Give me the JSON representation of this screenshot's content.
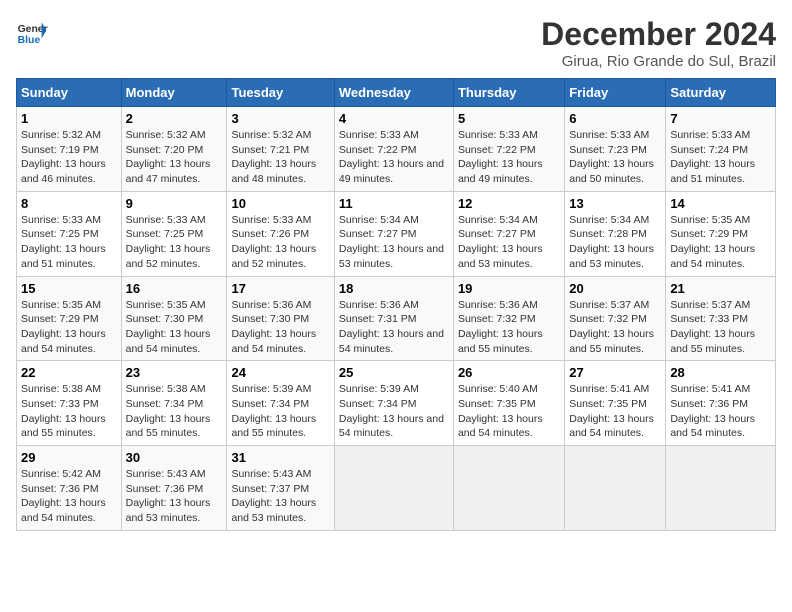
{
  "header": {
    "logo_line1": "General",
    "logo_line2": "Blue",
    "title": "December 2024",
    "subtitle": "Girua, Rio Grande do Sul, Brazil"
  },
  "weekdays": [
    "Sunday",
    "Monday",
    "Tuesday",
    "Wednesday",
    "Thursday",
    "Friday",
    "Saturday"
  ],
  "weeks": [
    [
      {
        "day": "1",
        "sunrise": "5:32 AM",
        "sunset": "7:19 PM",
        "daylight": "13 hours and 46 minutes."
      },
      {
        "day": "2",
        "sunrise": "5:32 AM",
        "sunset": "7:20 PM",
        "daylight": "13 hours and 47 minutes."
      },
      {
        "day": "3",
        "sunrise": "5:32 AM",
        "sunset": "7:21 PM",
        "daylight": "13 hours and 48 minutes."
      },
      {
        "day": "4",
        "sunrise": "5:33 AM",
        "sunset": "7:22 PM",
        "daylight": "13 hours and 49 minutes."
      },
      {
        "day": "5",
        "sunrise": "5:33 AM",
        "sunset": "7:22 PM",
        "daylight": "13 hours and 49 minutes."
      },
      {
        "day": "6",
        "sunrise": "5:33 AM",
        "sunset": "7:23 PM",
        "daylight": "13 hours and 50 minutes."
      },
      {
        "day": "7",
        "sunrise": "5:33 AM",
        "sunset": "7:24 PM",
        "daylight": "13 hours and 51 minutes."
      }
    ],
    [
      {
        "day": "8",
        "sunrise": "5:33 AM",
        "sunset": "7:25 PM",
        "daylight": "13 hours and 51 minutes."
      },
      {
        "day": "9",
        "sunrise": "5:33 AM",
        "sunset": "7:25 PM",
        "daylight": "13 hours and 52 minutes."
      },
      {
        "day": "10",
        "sunrise": "5:33 AM",
        "sunset": "7:26 PM",
        "daylight": "13 hours and 52 minutes."
      },
      {
        "day": "11",
        "sunrise": "5:34 AM",
        "sunset": "7:27 PM",
        "daylight": "13 hours and 53 minutes."
      },
      {
        "day": "12",
        "sunrise": "5:34 AM",
        "sunset": "7:27 PM",
        "daylight": "13 hours and 53 minutes."
      },
      {
        "day": "13",
        "sunrise": "5:34 AM",
        "sunset": "7:28 PM",
        "daylight": "13 hours and 53 minutes."
      },
      {
        "day": "14",
        "sunrise": "5:35 AM",
        "sunset": "7:29 PM",
        "daylight": "13 hours and 54 minutes."
      }
    ],
    [
      {
        "day": "15",
        "sunrise": "5:35 AM",
        "sunset": "7:29 PM",
        "daylight": "13 hours and 54 minutes."
      },
      {
        "day": "16",
        "sunrise": "5:35 AM",
        "sunset": "7:30 PM",
        "daylight": "13 hours and 54 minutes."
      },
      {
        "day": "17",
        "sunrise": "5:36 AM",
        "sunset": "7:30 PM",
        "daylight": "13 hours and 54 minutes."
      },
      {
        "day": "18",
        "sunrise": "5:36 AM",
        "sunset": "7:31 PM",
        "daylight": "13 hours and 54 minutes."
      },
      {
        "day": "19",
        "sunrise": "5:36 AM",
        "sunset": "7:32 PM",
        "daylight": "13 hours and 55 minutes."
      },
      {
        "day": "20",
        "sunrise": "5:37 AM",
        "sunset": "7:32 PM",
        "daylight": "13 hours and 55 minutes."
      },
      {
        "day": "21",
        "sunrise": "5:37 AM",
        "sunset": "7:33 PM",
        "daylight": "13 hours and 55 minutes."
      }
    ],
    [
      {
        "day": "22",
        "sunrise": "5:38 AM",
        "sunset": "7:33 PM",
        "daylight": "13 hours and 55 minutes."
      },
      {
        "day": "23",
        "sunrise": "5:38 AM",
        "sunset": "7:34 PM",
        "daylight": "13 hours and 55 minutes."
      },
      {
        "day": "24",
        "sunrise": "5:39 AM",
        "sunset": "7:34 PM",
        "daylight": "13 hours and 55 minutes."
      },
      {
        "day": "25",
        "sunrise": "5:39 AM",
        "sunset": "7:34 PM",
        "daylight": "13 hours and 54 minutes."
      },
      {
        "day": "26",
        "sunrise": "5:40 AM",
        "sunset": "7:35 PM",
        "daylight": "13 hours and 54 minutes."
      },
      {
        "day": "27",
        "sunrise": "5:41 AM",
        "sunset": "7:35 PM",
        "daylight": "13 hours and 54 minutes."
      },
      {
        "day": "28",
        "sunrise": "5:41 AM",
        "sunset": "7:36 PM",
        "daylight": "13 hours and 54 minutes."
      }
    ],
    [
      {
        "day": "29",
        "sunrise": "5:42 AM",
        "sunset": "7:36 PM",
        "daylight": "13 hours and 54 minutes."
      },
      {
        "day": "30",
        "sunrise": "5:43 AM",
        "sunset": "7:36 PM",
        "daylight": "13 hours and 53 minutes."
      },
      {
        "day": "31",
        "sunrise": "5:43 AM",
        "sunset": "7:37 PM",
        "daylight": "13 hours and 53 minutes."
      },
      null,
      null,
      null,
      null
    ]
  ]
}
